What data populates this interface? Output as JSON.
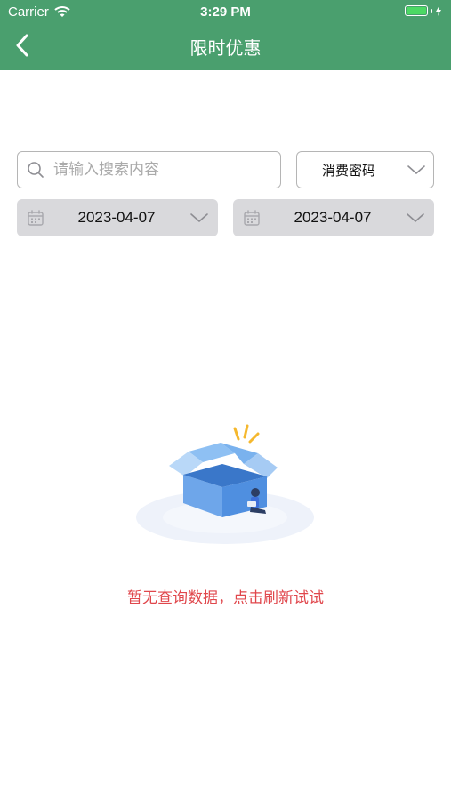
{
  "status_bar": {
    "carrier": "Carrier",
    "time": "3:29 PM"
  },
  "header": {
    "title": "限时优惠",
    "back_icon": "chevron-left-icon"
  },
  "search": {
    "placeholder": "请输入搜索内容",
    "value": ""
  },
  "filter": {
    "type_label": "消费密码"
  },
  "dates": {
    "start": "2023-04-07",
    "end": "2023-04-07"
  },
  "empty_state": {
    "message": "暂无查询数据，点击刷新试试",
    "illustration": "empty-box-illustration"
  },
  "colors": {
    "header_bg": "#4a9f6e",
    "empty_text": "#e0474c",
    "date_bg": "#d9d9dc"
  }
}
